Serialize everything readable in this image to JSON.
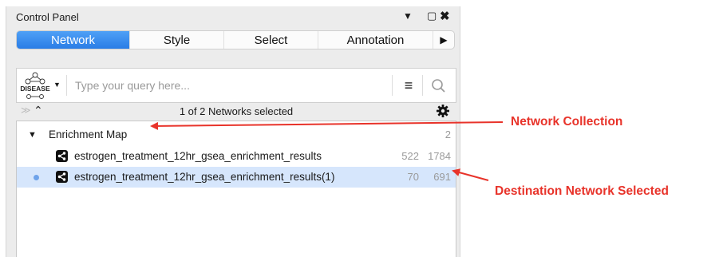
{
  "panel": {
    "title": "Control Panel"
  },
  "tabs": [
    {
      "label": "Network",
      "active": true
    },
    {
      "label": "Style",
      "active": false
    },
    {
      "label": "Select",
      "active": false
    },
    {
      "label": "Annotation",
      "active": false
    }
  ],
  "search": {
    "placeholder": "Type your query here...",
    "value": "",
    "logo_text": "DISEASE"
  },
  "status": {
    "selected_text": "1 of 2 Networks selected"
  },
  "collection": {
    "name": "Enrichment Map",
    "count": "2"
  },
  "networks": [
    {
      "name": "estrogen_treatment_12hr_gsea_enrichment_results",
      "nodes": "522",
      "edges": "1784",
      "selected": false
    },
    {
      "name": "estrogen_treatment_12hr_gsea_enrichment_results(1)",
      "nodes": "70",
      "edges": "691",
      "selected": true
    }
  ],
  "annotations": {
    "network_collection": "Network Collection",
    "destination_selected": "Destination Network Selected",
    "color": "#e8332a"
  },
  "colors": {
    "active_tab": "#2f83ea",
    "selected_row": "#d6e6fc"
  }
}
